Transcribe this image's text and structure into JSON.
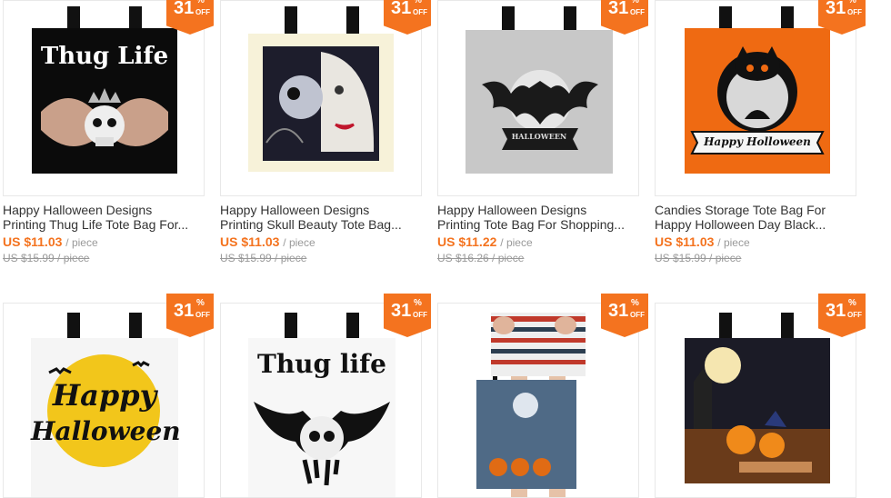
{
  "badge": {
    "number": "31",
    "percent": "%",
    "off": "OFF"
  },
  "products": [
    {
      "title_line1": "Happy Halloween Designs",
      "title_line2": "Printing Thug Life Tote Bag For...",
      "price": "US $11.03",
      "unit": "/ piece",
      "original": "US $15.99 / piece",
      "print_text": "Thug Life"
    },
    {
      "title_line1": "Happy Halloween Designs",
      "title_line2": "Printing Skull Beauty Tote Bag...",
      "price": "US $11.03",
      "unit": "/ piece",
      "original": "US $15.99 / piece"
    },
    {
      "title_line1": "Happy Halloween Designs",
      "title_line2": "Printing Tote Bag For Shopping...",
      "price": "US $11.22",
      "unit": "/ piece",
      "original": "US $16.26 / piece",
      "print_text": "HALLOWEEN"
    },
    {
      "title_line1": "Candies Storage Tote Bag For",
      "title_line2": "Happy Holloween Day Black...",
      "price": "US $11.03",
      "unit": "/ piece",
      "original": "US $15.99 / piece",
      "print_text": "Happy Holloween"
    },
    {
      "print_text_1": "Happy",
      "print_text_2": "Halloween"
    },
    {
      "print_text": "Thug life"
    },
    {},
    {}
  ]
}
